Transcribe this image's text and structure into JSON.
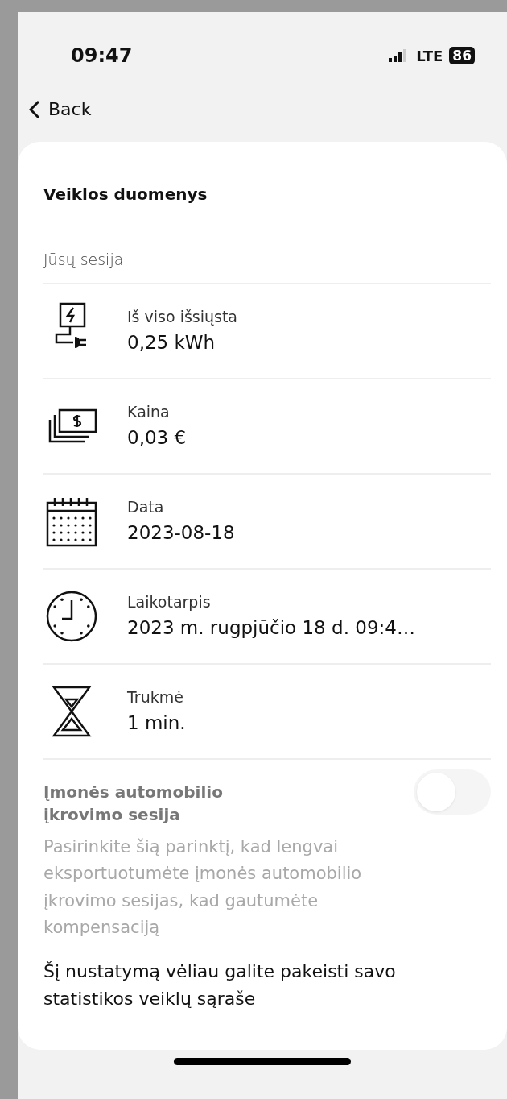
{
  "status_bar": {
    "time": "09:47",
    "network": "LTE",
    "battery": "86"
  },
  "nav": {
    "back": "Back"
  },
  "title": "Veiklos duomenys",
  "section": "Jūsų sesija",
  "rows": [
    {
      "kind": "energy",
      "label": "Iš viso išsiųsta",
      "value": "0,25 kWh"
    },
    {
      "kind": "price",
      "label": "Kaina",
      "value": "0,03 €"
    },
    {
      "kind": "date",
      "label": "Data",
      "value": "2023-08-18"
    },
    {
      "kind": "time",
      "label": "Laikotarpis",
      "value": "2023 m. rugpjūčio 18 d. 09:4…"
    },
    {
      "kind": "duration",
      "label": "Trukmė",
      "value": "1 min."
    }
  ],
  "company_toggle": {
    "label": "Įmonės automobilio įkrovimo sesija",
    "on": false,
    "disabled": true,
    "description": "Pasirinkite šią parinktį, kad lengvai eksportuotumėte įmonės automobilio įkrovimo sesijas, kad gautumėte kompensaciją"
  },
  "note": "Šį nustatymą vėliau galite pakeisti savo statistikos veiklų sąraše"
}
